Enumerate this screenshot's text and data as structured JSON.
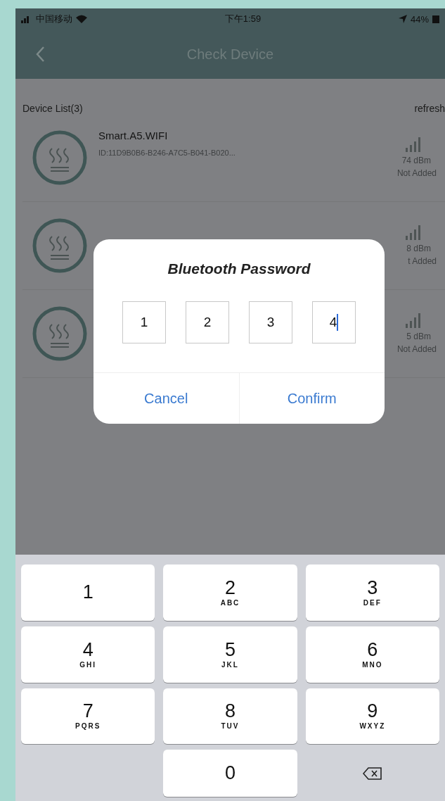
{
  "status_bar": {
    "carrier": "中国移动",
    "time": "下午1:59",
    "battery": "44%"
  },
  "nav": {
    "title": "Check Device"
  },
  "list_header": {
    "title": "Device List(3)",
    "action": "refresh"
  },
  "devices": [
    {
      "name": "Smart.A5.WIFI",
      "id": "ID:11D9B0B6-B246-A7C5-B041-B020...",
      "signal": "74 dBm",
      "status": "Not Added"
    },
    {
      "signal": "8 dBm",
      "status": "t Added"
    },
    {
      "signal": "5 dBm",
      "status": "Not Added"
    }
  ],
  "dialog": {
    "title": "Bluetooth Password",
    "digits": [
      "1",
      "2",
      "3",
      "4"
    ],
    "buttons": [
      "Cancel",
      "Confirm"
    ]
  },
  "keyboard": {
    "keys": [
      {
        "kind": "digit",
        "digit": "1"
      },
      {
        "kind": "digit",
        "digit": "2",
        "letters": "ABC"
      },
      {
        "kind": "digit",
        "digit": "3",
        "letters": "DEF"
      },
      {
        "kind": "digit",
        "digit": "4",
        "letters": "GHI"
      },
      {
        "kind": "digit",
        "digit": "5",
        "letters": "JKL"
      },
      {
        "kind": "digit",
        "digit": "6",
        "letters": "MNO"
      },
      {
        "kind": "digit",
        "digit": "7",
        "letters": "PQRS"
      },
      {
        "kind": "digit",
        "digit": "8",
        "letters": "TUV"
      },
      {
        "kind": "digit",
        "digit": "9",
        "letters": "WXYZ"
      },
      {
        "kind": "blank"
      },
      {
        "kind": "digit",
        "digit": "0"
      },
      {
        "kind": "backspace"
      }
    ]
  }
}
